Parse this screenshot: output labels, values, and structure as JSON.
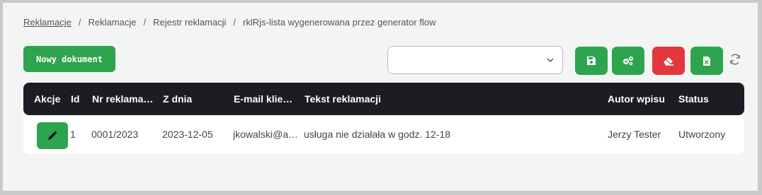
{
  "breadcrumb": [
    "Reklamacje",
    "Reklamacje",
    "Rejestr reklamacji",
    "rklRjs-lista wygenerowana przez generator flow"
  ],
  "breadcrumb_separator": "/",
  "toolbar": {
    "new_document_label": "Nowy dokument",
    "select_value": "",
    "icons": [
      "save-icon",
      "gears-icon",
      "eraser-icon",
      "excel-icon",
      "refresh-icon"
    ]
  },
  "table": {
    "headers": [
      "Akcje",
      "Id",
      "Nr reklama…",
      "Z dnia",
      "E-mail klie…",
      "Tekst reklamacji",
      "Autor wpisu",
      "Status"
    ],
    "rows": [
      {
        "id": "1",
        "number": "0001/2023",
        "date": "2023-12-05",
        "email": "jkowalski@a…",
        "text": "usługa nie działała w godz. 12-18",
        "author": "Jerzy Tester",
        "status": "Utworzony"
      }
    ]
  },
  "colors": {
    "accent_green": "#2ea44f",
    "danger_red": "#e0383c",
    "header_dark": "#1c1c22"
  }
}
